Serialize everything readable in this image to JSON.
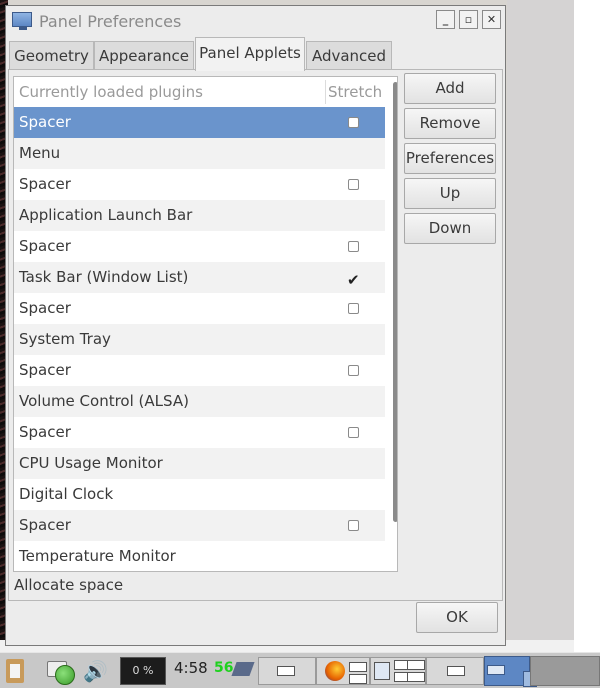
{
  "window": {
    "title": "Panel Preferences",
    "controls": [
      "_",
      "▫",
      "✕"
    ]
  },
  "tabs": [
    {
      "label": "Geometry",
      "active": false
    },
    {
      "label": "Appearance",
      "active": false
    },
    {
      "label": "Panel Applets",
      "active": true
    },
    {
      "label": "Advanced",
      "active": false
    }
  ],
  "list": {
    "header_name": "Currently loaded plugins",
    "header_stretch": "Stretch",
    "rows": [
      {
        "name": "Spacer",
        "checkbox": true,
        "checked": false,
        "selected": true
      },
      {
        "name": "Menu",
        "checkbox": false,
        "checked": false,
        "selected": false
      },
      {
        "name": "Spacer",
        "checkbox": true,
        "checked": false,
        "selected": false
      },
      {
        "name": "Application Launch Bar",
        "checkbox": false,
        "checked": false,
        "selected": false
      },
      {
        "name": "Spacer",
        "checkbox": true,
        "checked": false,
        "selected": false
      },
      {
        "name": "Task Bar (Window List)",
        "checkbox": true,
        "checked": true,
        "selected": false
      },
      {
        "name": "Spacer",
        "checkbox": true,
        "checked": false,
        "selected": false
      },
      {
        "name": "System Tray",
        "checkbox": false,
        "checked": false,
        "selected": false
      },
      {
        "name": "Spacer",
        "checkbox": true,
        "checked": false,
        "selected": false
      },
      {
        "name": "Volume Control (ALSA)",
        "checkbox": false,
        "checked": false,
        "selected": false
      },
      {
        "name": "Spacer",
        "checkbox": true,
        "checked": false,
        "selected": false
      },
      {
        "name": "CPU Usage Monitor",
        "checkbox": false,
        "checked": false,
        "selected": false
      },
      {
        "name": "Digital Clock",
        "checkbox": false,
        "checked": false,
        "selected": false
      },
      {
        "name": "Spacer",
        "checkbox": true,
        "checked": false,
        "selected": false
      },
      {
        "name": "Temperature Monitor",
        "checkbox": false,
        "checked": false,
        "selected": false
      }
    ]
  },
  "side_buttons": {
    "add": "Add",
    "remove": "Remove",
    "preferences": "Preferences",
    "up": "Up",
    "down": "Down"
  },
  "status_text": "Allocate space",
  "ok_label": "OK",
  "taskbar": {
    "cpu_text": "0 %",
    "clock": "4:58",
    "temperature": "56",
    "icons": [
      "clipboard-icon",
      "chat-icon",
      "globe-icon",
      "speaker-icon",
      "cpu-monitor",
      "eject-icon",
      "firefox-icon",
      "window-list-icon",
      "pager-icon"
    ]
  },
  "colors": {
    "selection": "#6a94cc",
    "temperature": "#1fd11f",
    "pager_active": "#5d87c4"
  }
}
